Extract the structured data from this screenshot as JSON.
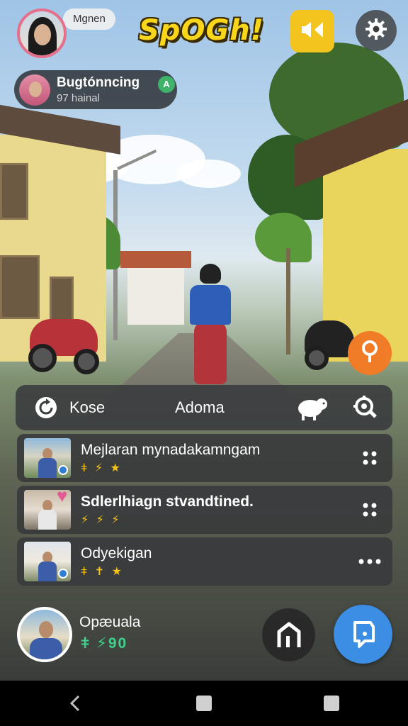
{
  "header": {
    "username": "Mgnen",
    "logo_text": "SpOGh!"
  },
  "live_card": {
    "title": "Bugtónncing",
    "subtitle": "97 hainal",
    "badge": "A"
  },
  "toolbar": {
    "left_label": "Kose",
    "center_label": "Adoma"
  },
  "list": {
    "items": [
      {
        "title": "Mejlaran mynadakamngam",
        "rating": "ǂ ⚡ ★"
      },
      {
        "title": "Sdlerlhiagn stvandtined.",
        "rating": "⚡ ⚡ ⚡"
      },
      {
        "title": "Odyekigan",
        "rating": "ǂ ✝ ★"
      }
    ]
  },
  "profile": {
    "name": "Opæuala",
    "score": "ǂ ⚡90"
  },
  "colors": {
    "accent_yellow": "#f4c41e",
    "accent_orange": "#f07c27",
    "accent_blue": "#3b8ee4",
    "score_green": "#3ed28c",
    "avatar_ring": "#e4708c"
  },
  "icons": {
    "sound": "speaker-icon",
    "settings": "gear-icon",
    "location": "location-pin-icon",
    "toolbar_left": "refresh-icon",
    "toolbar_pet": "sheep-icon",
    "toolbar_search": "search-gear-icon",
    "row_menu": "dots-grid-icon",
    "home": "home-icon",
    "chat": "chat-icon"
  }
}
